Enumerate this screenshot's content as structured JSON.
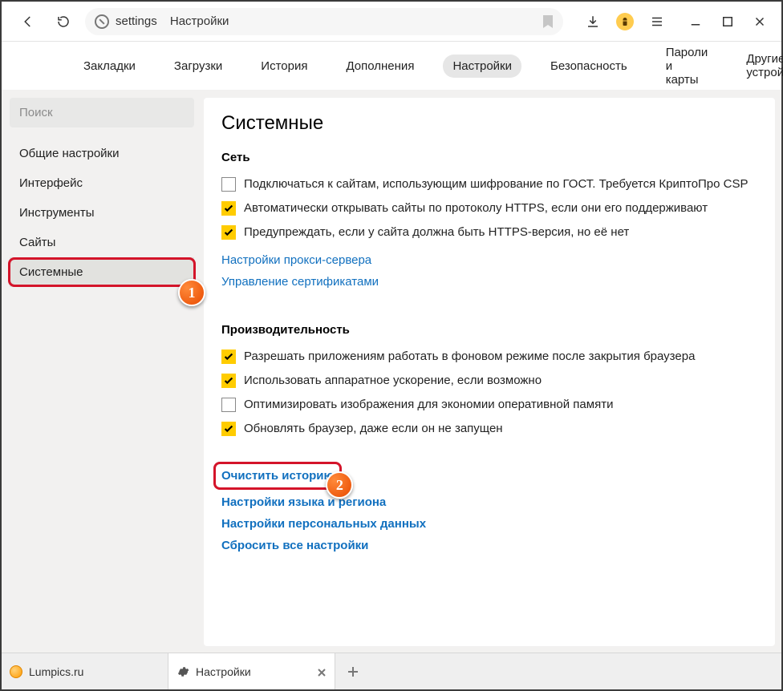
{
  "toolbar": {
    "address_prefix": "settings",
    "address_title": "Настройки"
  },
  "nav": {
    "items": [
      "Закладки",
      "Загрузки",
      "История",
      "Дополнения",
      "Настройки",
      "Безопасность",
      "Пароли и карты",
      "Другие устройства"
    ],
    "active_index": 4
  },
  "sidebar": {
    "search_placeholder": "Поиск",
    "items": [
      "Общие настройки",
      "Интерфейс",
      "Инструменты",
      "Сайты",
      "Системные"
    ],
    "active_index": 4
  },
  "content": {
    "heading": "Системные",
    "section_network": {
      "title": "Сеть",
      "checkboxes": [
        {
          "checked": false,
          "label": "Подключаться к сайтам, использующим шифрование по ГОСТ. Требуется КриптоПро CSP"
        },
        {
          "checked": true,
          "label": "Автоматически открывать сайты по протоколу HTTPS, если они его поддерживают"
        },
        {
          "checked": true,
          "label": "Предупреждать, если у сайта должна быть HTTPS-версия, но её нет"
        }
      ],
      "links": [
        "Настройки прокси-сервера",
        "Управление сертификатами"
      ]
    },
    "section_perf": {
      "title": "Производительность",
      "checkboxes": [
        {
          "checked": true,
          "label": "Разрешать приложениям работать в фоновом режиме после закрытия браузера"
        },
        {
          "checked": true,
          "label": "Использовать аппаратное ускорение, если возможно"
        },
        {
          "checked": false,
          "label": "Оптимизировать изображения для экономии оперативной памяти"
        },
        {
          "checked": true,
          "label": "Обновлять браузер, даже если он не запущен"
        }
      ]
    },
    "bottom_links": {
      "clear_history": "Очистить историю",
      "others": [
        "Настройки языка и региона",
        "Настройки персональных данных",
        "Сбросить все настройки"
      ]
    }
  },
  "tabs": {
    "items": [
      {
        "title": "Lumpics.ru",
        "favicon": "orange",
        "active": false
      },
      {
        "title": "Настройки",
        "favicon": "gear",
        "active": true
      }
    ]
  },
  "callouts": {
    "one": "1",
    "two": "2"
  }
}
